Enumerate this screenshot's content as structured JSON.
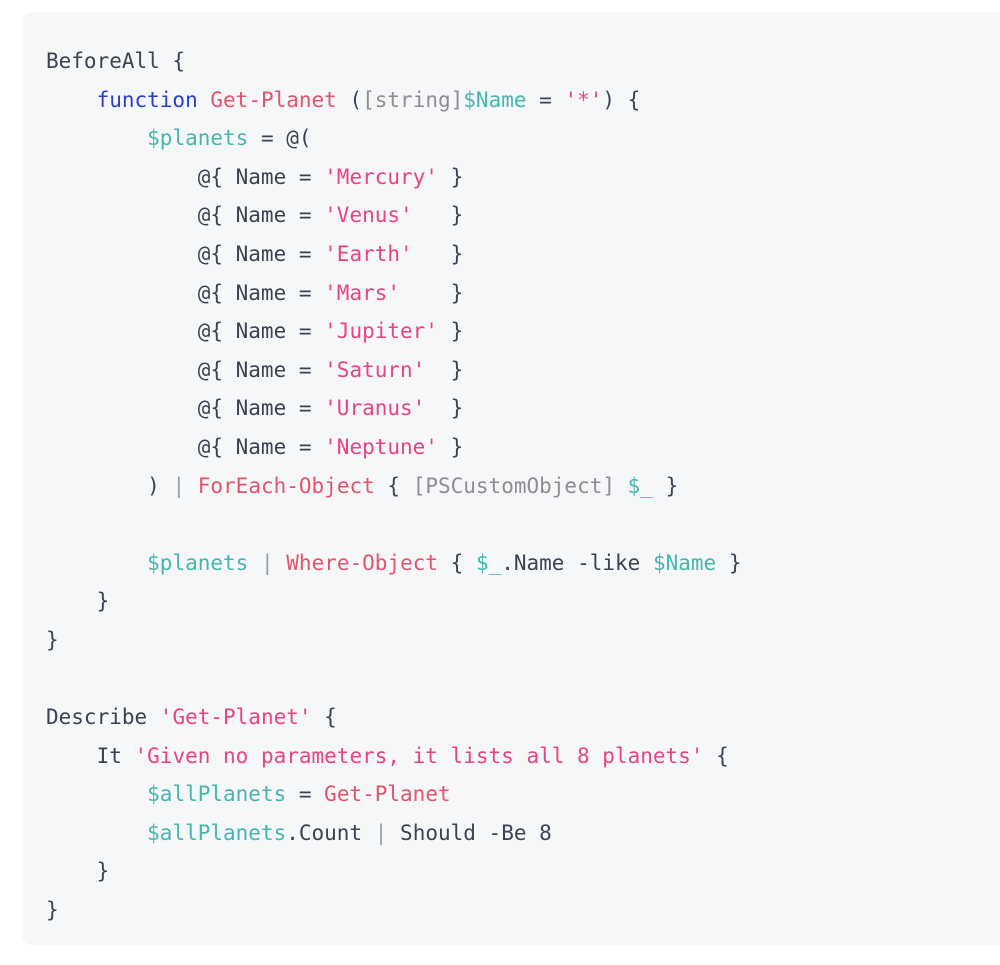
{
  "panel": {
    "background_color": "#f6f7f9",
    "language": "powershell",
    "corner_radius_px": 10
  },
  "theme": {
    "default_text": "#3b4252",
    "keyword": "#2a3fd0",
    "cmdlet": "#e4536a",
    "variable": "#45b6b0",
    "string": "#e8447f",
    "type": "#8d8d92",
    "pipe": "#9aa0a6",
    "page_background": "#ffffff"
  },
  "code": {
    "lines": [
      {
        "id": "line-1",
        "tokens": [
          {
            "t": "BeforeAll {",
            "c": "t-plain"
          }
        ]
      },
      {
        "id": "line-2",
        "tokens": [
          {
            "t": "    ",
            "c": "t-plain"
          },
          {
            "t": "function",
            "c": "t-kw"
          },
          {
            "t": " ",
            "c": "t-plain"
          },
          {
            "t": "Get-Planet",
            "c": "t-cmd"
          },
          {
            "t": " (",
            "c": "t-punc"
          },
          {
            "t": "[string]",
            "c": "t-type"
          },
          {
            "t": "$Name",
            "c": "t-var"
          },
          {
            "t": " = ",
            "c": "t-punc"
          },
          {
            "t": "'*'",
            "c": "t-str"
          },
          {
            "t": ") {",
            "c": "t-punc"
          }
        ]
      },
      {
        "id": "line-3",
        "tokens": [
          {
            "t": "        ",
            "c": "t-plain"
          },
          {
            "t": "$planets",
            "c": "t-var"
          },
          {
            "t": " = @(",
            "c": "t-punc"
          }
        ]
      },
      {
        "id": "line-4",
        "tokens": [
          {
            "t": "            @{ Name = ",
            "c": "t-plain"
          },
          {
            "t": "'Mercury'",
            "c": "t-str"
          },
          {
            "t": " }",
            "c": "t-plain"
          }
        ]
      },
      {
        "id": "line-5",
        "tokens": [
          {
            "t": "            @{ Name = ",
            "c": "t-plain"
          },
          {
            "t": "'Venus'",
            "c": "t-str"
          },
          {
            "t": "   }",
            "c": "t-plain"
          }
        ]
      },
      {
        "id": "line-6",
        "tokens": [
          {
            "t": "            @{ Name = ",
            "c": "t-plain"
          },
          {
            "t": "'Earth'",
            "c": "t-str"
          },
          {
            "t": "   }",
            "c": "t-plain"
          }
        ]
      },
      {
        "id": "line-7",
        "tokens": [
          {
            "t": "            @{ Name = ",
            "c": "t-plain"
          },
          {
            "t": "'Mars'",
            "c": "t-str"
          },
          {
            "t": "    }",
            "c": "t-plain"
          }
        ]
      },
      {
        "id": "line-8",
        "tokens": [
          {
            "t": "            @{ Name = ",
            "c": "t-plain"
          },
          {
            "t": "'Jupiter'",
            "c": "t-str"
          },
          {
            "t": " }",
            "c": "t-plain"
          }
        ]
      },
      {
        "id": "line-9",
        "tokens": [
          {
            "t": "            @{ Name = ",
            "c": "t-plain"
          },
          {
            "t": "'Saturn'",
            "c": "t-str"
          },
          {
            "t": "  }",
            "c": "t-plain"
          }
        ]
      },
      {
        "id": "line-10",
        "tokens": [
          {
            "t": "            @{ Name = ",
            "c": "t-plain"
          },
          {
            "t": "'Uranus'",
            "c": "t-str"
          },
          {
            "t": "  }",
            "c": "t-plain"
          }
        ]
      },
      {
        "id": "line-11",
        "tokens": [
          {
            "t": "            @{ Name = ",
            "c": "t-plain"
          },
          {
            "t": "'Neptune'",
            "c": "t-str"
          },
          {
            "t": " }",
            "c": "t-plain"
          }
        ]
      },
      {
        "id": "line-12",
        "tokens": [
          {
            "t": "        ) ",
            "c": "t-punc"
          },
          {
            "t": "|",
            "c": "t-pipe"
          },
          {
            "t": " ",
            "c": "t-plain"
          },
          {
            "t": "ForEach-Object",
            "c": "t-cmd"
          },
          {
            "t": " { ",
            "c": "t-punc"
          },
          {
            "t": "[PSCustomObject]",
            "c": "t-type"
          },
          {
            "t": " ",
            "c": "t-plain"
          },
          {
            "t": "$_",
            "c": "t-var"
          },
          {
            "t": " }",
            "c": "t-punc"
          }
        ]
      },
      {
        "id": "line-13",
        "tokens": [
          {
            "t": "",
            "c": "t-plain"
          }
        ]
      },
      {
        "id": "line-14",
        "tokens": [
          {
            "t": "        ",
            "c": "t-plain"
          },
          {
            "t": "$planets",
            "c": "t-var"
          },
          {
            "t": " ",
            "c": "t-plain"
          },
          {
            "t": "|",
            "c": "t-pipe"
          },
          {
            "t": " ",
            "c": "t-plain"
          },
          {
            "t": "Where-Object",
            "c": "t-cmd"
          },
          {
            "t": " { ",
            "c": "t-punc"
          },
          {
            "t": "$_",
            "c": "t-var"
          },
          {
            "t": ".Name -like ",
            "c": "t-plain"
          },
          {
            "t": "$Name",
            "c": "t-var"
          },
          {
            "t": " }",
            "c": "t-punc"
          }
        ]
      },
      {
        "id": "line-15",
        "tokens": [
          {
            "t": "    }",
            "c": "t-plain"
          }
        ]
      },
      {
        "id": "line-16",
        "tokens": [
          {
            "t": "}",
            "c": "t-plain"
          }
        ]
      },
      {
        "id": "line-17",
        "tokens": [
          {
            "t": "",
            "c": "t-plain"
          }
        ]
      },
      {
        "id": "line-18",
        "tokens": [
          {
            "t": "Describe ",
            "c": "t-plain"
          },
          {
            "t": "'Get-Planet'",
            "c": "t-str"
          },
          {
            "t": " {",
            "c": "t-plain"
          }
        ]
      },
      {
        "id": "line-19",
        "tokens": [
          {
            "t": "    It ",
            "c": "t-plain"
          },
          {
            "t": "'Given no parameters, it lists all 8 planets'",
            "c": "t-str"
          },
          {
            "t": " {",
            "c": "t-plain"
          }
        ]
      },
      {
        "id": "line-20",
        "tokens": [
          {
            "t": "        ",
            "c": "t-plain"
          },
          {
            "t": "$allPlanets",
            "c": "t-var"
          },
          {
            "t": " = ",
            "c": "t-punc"
          },
          {
            "t": "Get-Planet",
            "c": "t-cmd"
          }
        ]
      },
      {
        "id": "line-21",
        "tokens": [
          {
            "t": "        ",
            "c": "t-plain"
          },
          {
            "t": "$allPlanets",
            "c": "t-var"
          },
          {
            "t": ".Count ",
            "c": "t-plain"
          },
          {
            "t": "|",
            "c": "t-pipe"
          },
          {
            "t": " Should -Be ",
            "c": "t-plain"
          },
          {
            "t": "8",
            "c": "t-num"
          }
        ]
      },
      {
        "id": "line-22",
        "tokens": [
          {
            "t": "    }",
            "c": "t-plain"
          }
        ]
      },
      {
        "id": "line-23",
        "tokens": [
          {
            "t": "}",
            "c": "t-plain"
          }
        ]
      }
    ],
    "plain_text": "BeforeAll {\n    function Get-Planet ([string]$Name = '*') {\n        $planets = @(\n            @{ Name = 'Mercury' }\n            @{ Name = 'Venus'   }\n            @{ Name = 'Earth'   }\n            @{ Name = 'Mars'    }\n            @{ Name = 'Jupiter' }\n            @{ Name = 'Saturn'  }\n            @{ Name = 'Uranus'  }\n            @{ Name = 'Neptune' }\n        ) | ForEach-Object { [PSCustomObject] $_ }\n\n        $planets | Where-Object { $_.Name -like $Name }\n    }\n}\n\nDescribe 'Get-Planet' {\n    It 'Given no parameters, it lists all 8 planets' {\n        $allPlanets = Get-Planet\n        $allPlanets.Count | Should -Be 8\n    }\n}"
  }
}
